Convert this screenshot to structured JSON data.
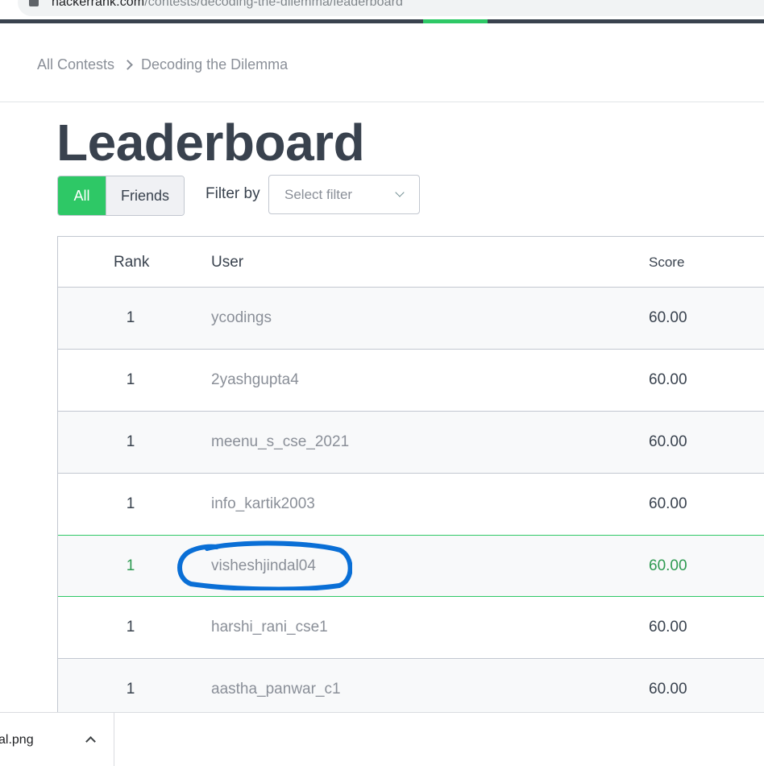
{
  "browser": {
    "url_host": "hackerrank.com",
    "url_path": "/contests/decoding-the-dilemma/leaderboard"
  },
  "breadcrumb": {
    "items": [
      "All Contests",
      "Decoding the Dilemma"
    ]
  },
  "page": {
    "title": "Leaderboard"
  },
  "toggle": {
    "all_label": "All",
    "friends_label": "Friends",
    "selected": "All"
  },
  "filter": {
    "label": "Filter by",
    "placeholder": "Select filter"
  },
  "table": {
    "headers": {
      "rank": "Rank",
      "user": "User",
      "score": "Score"
    },
    "rows": [
      {
        "rank": "1",
        "user": "ycodings",
        "score": "60.00"
      },
      {
        "rank": "1",
        "user": "2yashgupta4",
        "score": "60.00"
      },
      {
        "rank": "1",
        "user": "meenu_s_cse_2021",
        "score": "60.00"
      },
      {
        "rank": "1",
        "user": "info_kartik2003",
        "score": "60.00"
      },
      {
        "rank": "1",
        "user": "visheshjindal04",
        "score": "60.00",
        "highlighted": true
      },
      {
        "rank": "1",
        "user": "harshi_rani_cse1",
        "score": "60.00"
      },
      {
        "rank": "1",
        "user": "aastha_panwar_c1",
        "score": "60.00"
      }
    ]
  },
  "download": {
    "filename": "al.png"
  },
  "colors": {
    "accent": "#2ec866",
    "annotation": "#0a6fd6",
    "text_dark": "#39424e"
  }
}
